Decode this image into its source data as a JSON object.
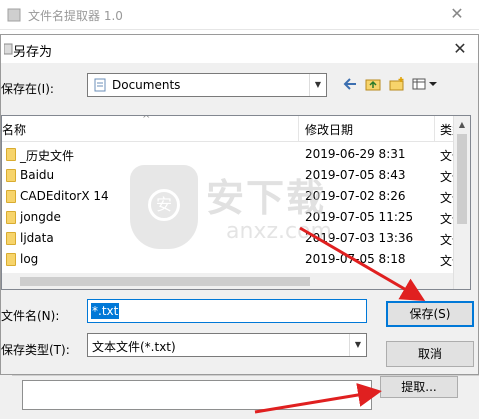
{
  "app": {
    "title": "文件名提取器 1.0",
    "extract_button": "提取..."
  },
  "dialog": {
    "title": "另存为",
    "save_in_label": "保存在(I):",
    "save_in_value": "Documents",
    "columns": {
      "name": "名称",
      "date": "修改日期",
      "type": "类型"
    },
    "files": [
      {
        "name": "_历史文件",
        "date": "2019-06-29 8:31",
        "type": "文件"
      },
      {
        "name": "Baidu",
        "date": "2019-07-05 8:43",
        "type": "文件"
      },
      {
        "name": "CADEditorX 14",
        "date": "2019-07-02 8:26",
        "type": "文件"
      },
      {
        "name": "jongde",
        "date": "2019-07-05 11:25",
        "type": "文件"
      },
      {
        "name": "ljdata",
        "date": "2019-07-03 13:36",
        "type": "文件"
      },
      {
        "name": "log",
        "date": "2019-07-05 8:18",
        "type": "文件"
      }
    ],
    "filename_label": "文件名(N):",
    "filename_value": "*.txt",
    "filetype_label": "保存类型(T):",
    "filetype_value": "文本文件(*.txt)",
    "save_button": "保存(S)",
    "cancel_button": "取消"
  },
  "watermark": {
    "cn": "安下载",
    "en": "anxz.com"
  },
  "colors": {
    "accent": "#0078d7",
    "annotation": "#e02020",
    "folder": "#f7d46b"
  }
}
